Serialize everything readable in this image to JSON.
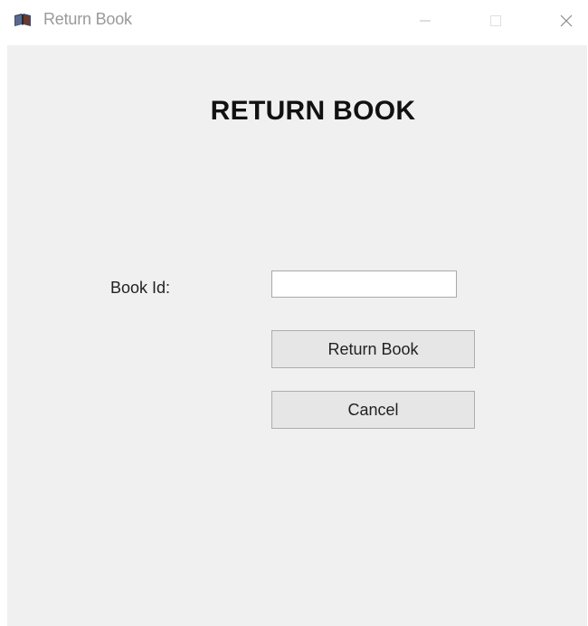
{
  "window": {
    "title": "Return Book",
    "icon": "book-icon",
    "controls": [
      "minimize-icon",
      "maximize-icon",
      "close-icon"
    ]
  },
  "form": {
    "heading": "RETURN BOOK",
    "book_id_label": "Book Id:",
    "book_id_value": "",
    "return_button_label": "Return Book",
    "cancel_button_label": "Cancel"
  },
  "colors": {
    "titlebar_bg": "#ffffff",
    "client_bg": "#f0f0f0",
    "button_bg": "#e6e6e6",
    "title_text": "#9a9a9a"
  }
}
